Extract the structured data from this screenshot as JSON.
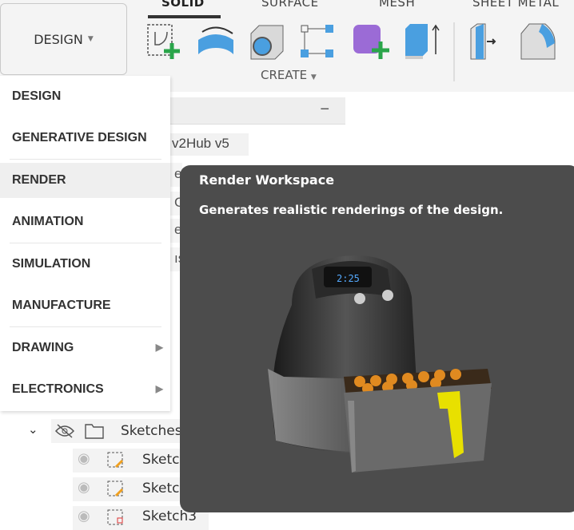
{
  "workspace_button": {
    "label": "DESIGN"
  },
  "toolbar": {
    "tabs": [
      "SOLID",
      "SURFACE",
      "MESH",
      "SHEET METAL"
    ],
    "active_tab": "SOLID",
    "create_label": "CREATE"
  },
  "browser": {
    "title_fragment": "v2Hub v5",
    "fragments": [
      "e",
      "C",
      "e",
      "ıs"
    ],
    "folder": "Sketches",
    "sketches": [
      "Sketc",
      "Sketc",
      "Sketch3"
    ]
  },
  "menu": {
    "items": [
      {
        "label": "DESIGN"
      },
      {
        "label": "GENERATIVE DESIGN"
      },
      {
        "label": "RENDER"
      },
      {
        "label": "ANIMATION"
      },
      {
        "label": "SIMULATION"
      },
      {
        "label": "MANUFACTURE"
      },
      {
        "label": "DRAWING"
      },
      {
        "label": "ELECTRONICS"
      }
    ]
  },
  "tooltip": {
    "title": "Render Workspace",
    "description": "Generates realistic renderings of the design.",
    "display_text": "2:25"
  }
}
